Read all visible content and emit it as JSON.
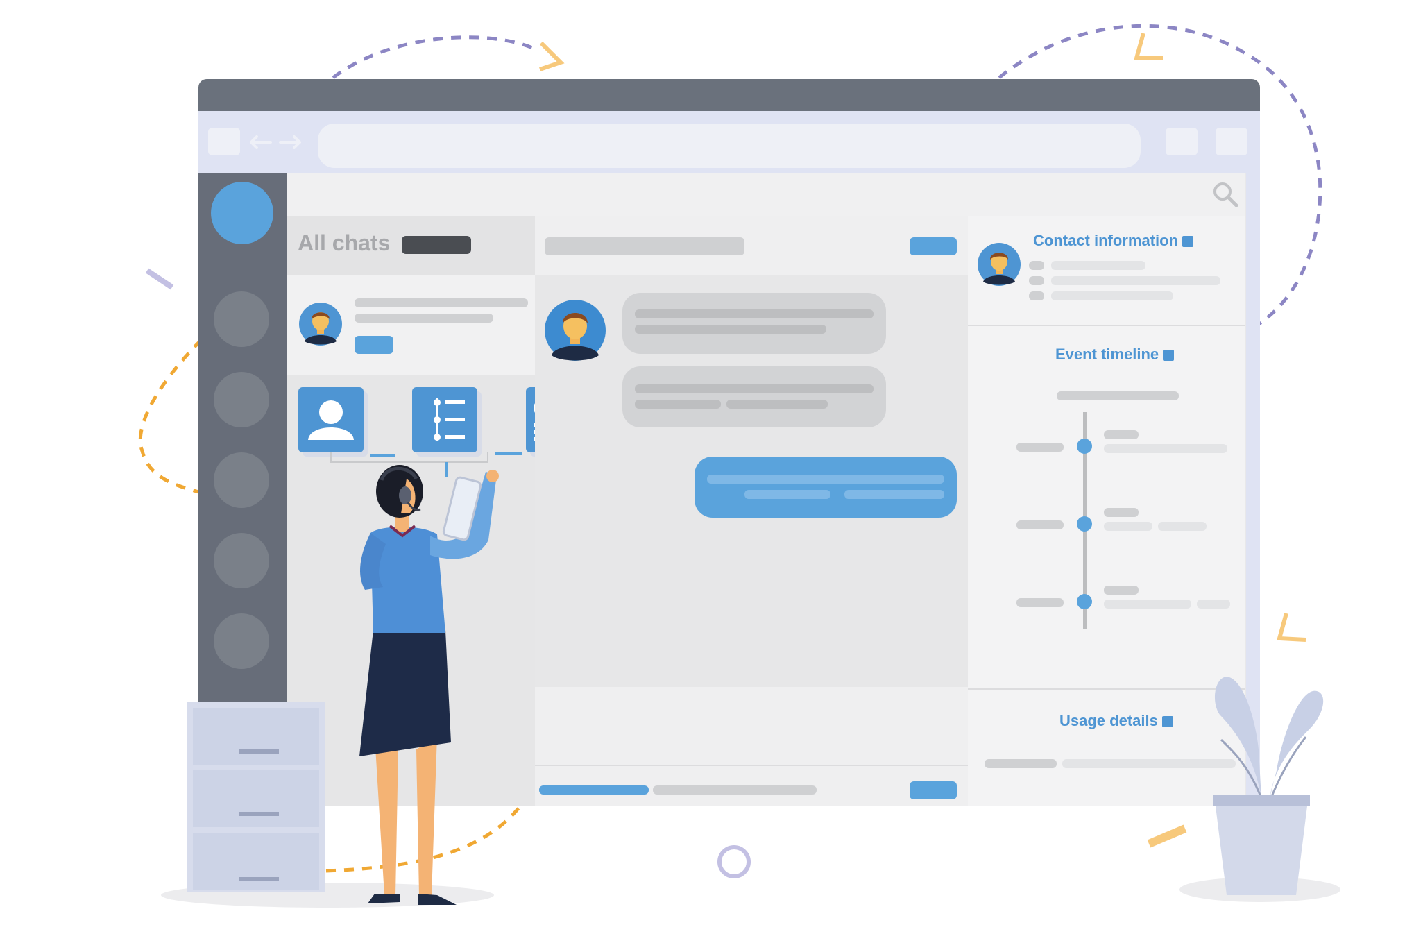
{
  "chat_list": {
    "title": "All chats"
  },
  "contact_panel": {
    "contact_heading": "Contact information",
    "timeline_heading": "Event timeline",
    "usage_heading": "Usage details"
  },
  "icons": [
    "back-arrow-icon",
    "forward-arrow-icon",
    "search-icon",
    "contact-card-icon",
    "calendar-icon",
    "id-card-icon",
    "user-icon",
    "timeline-list-icon"
  ],
  "colors": {
    "accent": "#5aa3dc",
    "rail": "#676d79",
    "titlebar": "#6a717c",
    "dashed_orange": "#f0a833",
    "dashed_purple": "#8c86c4"
  }
}
